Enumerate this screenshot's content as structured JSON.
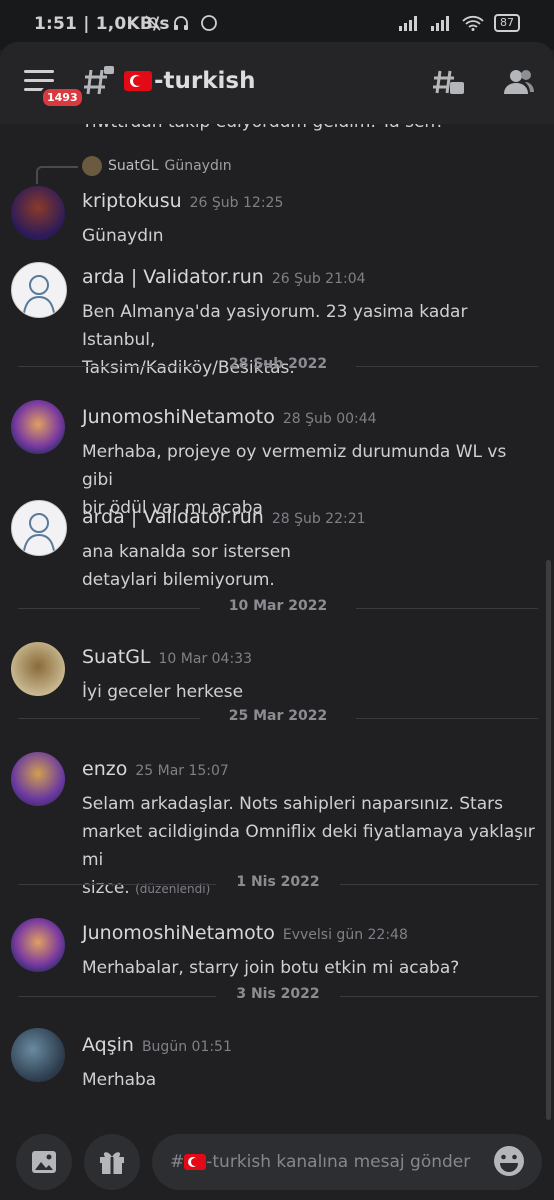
{
  "status_bar": {
    "time": "1:51",
    "speed": "1,0KB/s",
    "battery": "87"
  },
  "header": {
    "badge": "1493",
    "channel_name": "-turkish"
  },
  "partial_message": "Tiwttrdan takip ediyordum geldim. Ya sen?",
  "reply_preview": {
    "author": "SuatGL",
    "text": "Günaydın"
  },
  "messages": [
    {
      "author": "kriptokusu",
      "time": "26 Şub 12:25",
      "lines": [
        "Günaydın"
      ]
    },
    {
      "author": "arda | Validator.run",
      "time": "26 Şub 21:04",
      "lines": [
        "Ben Almanya'da yasiyorum. 23 yasima kadar Istanbul,",
        "Taksim/Kadiköy/Besiktas."
      ]
    },
    {
      "author": "JunomoshiNetamoto",
      "time": "28 Şub 00:44",
      "lines": [
        "Merhaba, projeye oy vermemiz durumunda WL vs gibi",
        "bir ödül var mı acaba"
      ]
    },
    {
      "author": "arda | Validator.run",
      "time": "28 Şub 22:21",
      "lines": [
        "ana kanalda sor istersen",
        "detaylari bilemiyorum."
      ]
    },
    {
      "author": "SuatGL",
      "time": "10 Mar 04:33",
      "lines": [
        "İyi geceler herkese"
      ]
    },
    {
      "author": "enzo",
      "time": "25 Mar 15:07",
      "lines": [
        "Selam arkadaşlar. Nots sahipleri naparsınız. Stars",
        "market acildiginda Omniflix deki fiyatlamaya yaklaşır mi",
        "sizce."
      ],
      "edited": "(düzenlendi)"
    },
    {
      "author": "JunomoshiNetamoto",
      "time": "Evvelsi gün 22:48",
      "lines": [
        "Merhabalar, starry join botu etkin mi acaba?"
      ]
    },
    {
      "author": "Aqşin",
      "time": "Bugün 01:51",
      "lines": [
        "Merhaba"
      ]
    }
  ],
  "dividers": [
    "28 Şub 2022",
    "10 Mar 2022",
    "25 Mar 2022",
    "1 Nis 2022",
    "3 Nis 2022"
  ],
  "composer": {
    "placeholder": "-turkish kanalına mesaj gönder",
    "hash": "#"
  },
  "icons": [
    "menu-icon",
    "locked-channel-icon",
    "threads-icon",
    "members-icon",
    "image-icon",
    "gift-icon",
    "emoji-icon"
  ]
}
